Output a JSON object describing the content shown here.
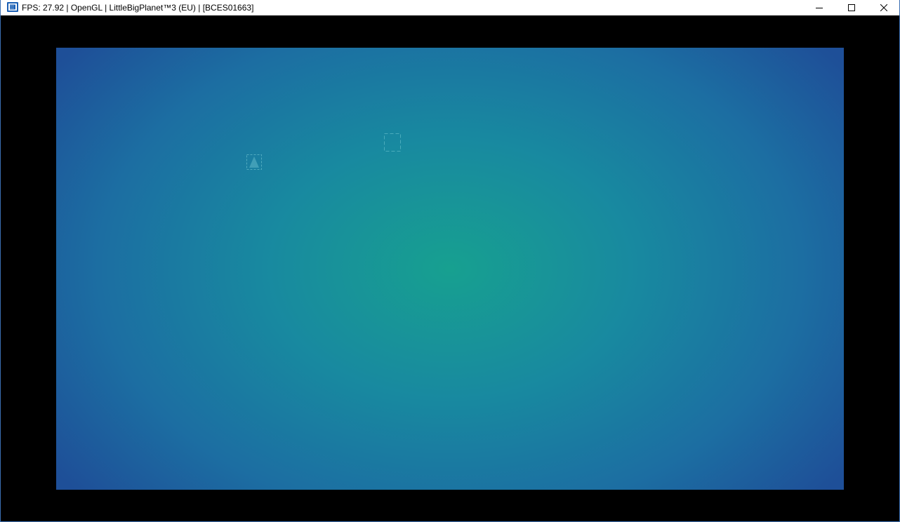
{
  "window": {
    "title": "FPS: 27.92 | OpenGL | LittleBigPlanet™3 (EU) | [BCES01663]",
    "app_icon": "rpcs3-icon",
    "controls": {
      "minimize_icon": "minimize-icon",
      "maximize_icon": "maximize-icon",
      "close_icon": "close-icon"
    }
  },
  "game_view": {
    "background_center_color": "#17a090",
    "background_edge_color": "#1e4f98",
    "letterbox_color": "#000000",
    "glyphs": [
      "loading-glyph-triangle-icon",
      "loading-glyph-square-icon"
    ]
  }
}
